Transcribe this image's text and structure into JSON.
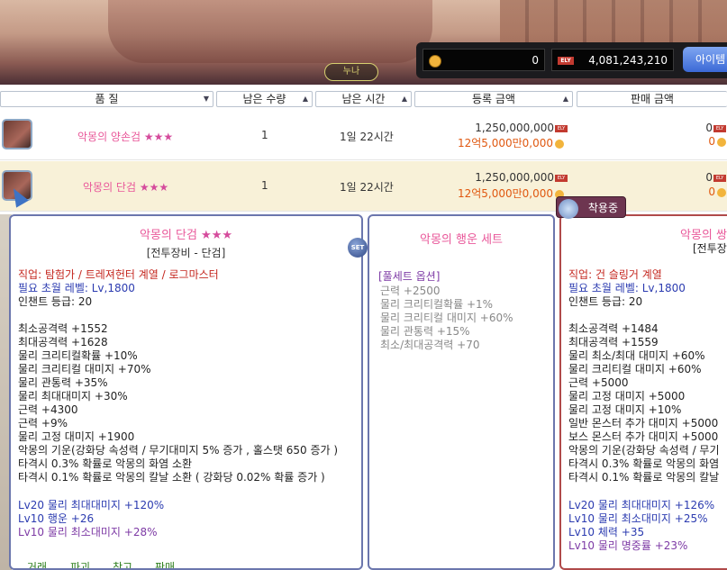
{
  "top": {
    "label_lamp": "누나",
    "coin_value": "0",
    "ely_tag": "ELY",
    "ely_value": "4,081,243,210",
    "item_button": "아이템"
  },
  "columns": {
    "grade": "품 질",
    "remaining_qty": "남은 수량",
    "remaining_time": "남은 시간",
    "reg_price": "등록 금액",
    "sell_price": "판매 금액"
  },
  "rows": [
    {
      "name": "악몽의 양손검",
      "stars": "★★★",
      "qty": "1",
      "time": "1일 22시간",
      "price": "1,250,000,000",
      "price_alt": "12억5,000만0,000",
      "sell": "0",
      "sell2": "0"
    },
    {
      "name": "악몽의 단검",
      "stars": "★★★",
      "qty": "1",
      "time": "1일 22시간",
      "price": "1,250,000,000",
      "price_alt": "12억5,000만0,000",
      "sell": "0",
      "sell2": "0"
    }
  ],
  "tooltip_main": {
    "title": "악몽의 단검",
    "stars": "★★★",
    "subtitle": "[전투장비 - 단검]",
    "job": "직업: 탐험가 / 트레져헌터 계열 / 로그마스터",
    "level_req": "필요 초월 레벨: Lv,1800",
    "enchant": "인챈트 등급: 20",
    "stats": [
      "최소공격력 +1552",
      "최대공격력 +1628",
      "물리 크리티컬확률 +10%",
      "물리 크리티컬 대미지 +70%",
      "물리 관통력 +35%",
      "물리 최대대미지 +30%",
      "근력 +4300",
      "근력 +9%",
      "물리 고정 대미지 +1900"
    ],
    "special": [
      "악몽의 기운(강화당  속성력 / 무기대미지 5% 증가 , 홀스탯 650 증가 )",
      "타격시 0.3% 확률로 악몽의 화염 소환",
      "타격시 0.1% 확률로 악몽의 칼날 소환 ( 강화당 0.02% 확률 증가 )"
    ],
    "options": [
      "Lv20 물리 최대대미지 +120%",
      "Lv10 행운 +26",
      "Lv10 물리 최소대미지 +28%"
    ],
    "buttons": [
      "거래",
      "파괴",
      "창고",
      "판매"
    ]
  },
  "set_badge": "SET",
  "tooltip_set": {
    "title": "악몽의 행운 세트",
    "header": "[풀세트 옵션]",
    "lines": [
      "근력 +2500",
      "물리 크리티컬확률 +1%",
      "물리 크리티컬 대미지 +60%",
      "물리 관통력 +15%",
      "최소/최대공격력 +70"
    ]
  },
  "equipped_label": "착용중",
  "tooltip_equipped": {
    "title": "악몽의 쌍",
    "subtitle": "[전투장",
    "job": "직업: 건 슬링거 계열",
    "level_req": "필요 초월 레벨: Lv,1800",
    "enchant": "인챈트 등급: 20",
    "stats": [
      "최소공격력 +1484",
      "최대공격력 +1559",
      "물리 최소/최대 대미지 +60%",
      "물리 크리티컬 대미지 +60%",
      "근력 +5000",
      "물리 고정 대미지 +5000",
      "물리 고정 대미지 +10%",
      "일반 몬스터 추가 대미지 +5000",
      "보스 몬스터 추가 대미지 +5000"
    ],
    "special": [
      "악몽의 기운(강화당  속성력 / 무기",
      "타격시 0.3% 확률로 악몽의 화염",
      "타격시 0.1% 확률로 악몽의 칼날"
    ],
    "options": [
      "Lv20 물리 최대대미지 +126%",
      "Lv10 물리 최소대미지 +25%",
      "Lv10 체력 +35",
      "Lv10 물리 명중률 +23%"
    ]
  }
}
